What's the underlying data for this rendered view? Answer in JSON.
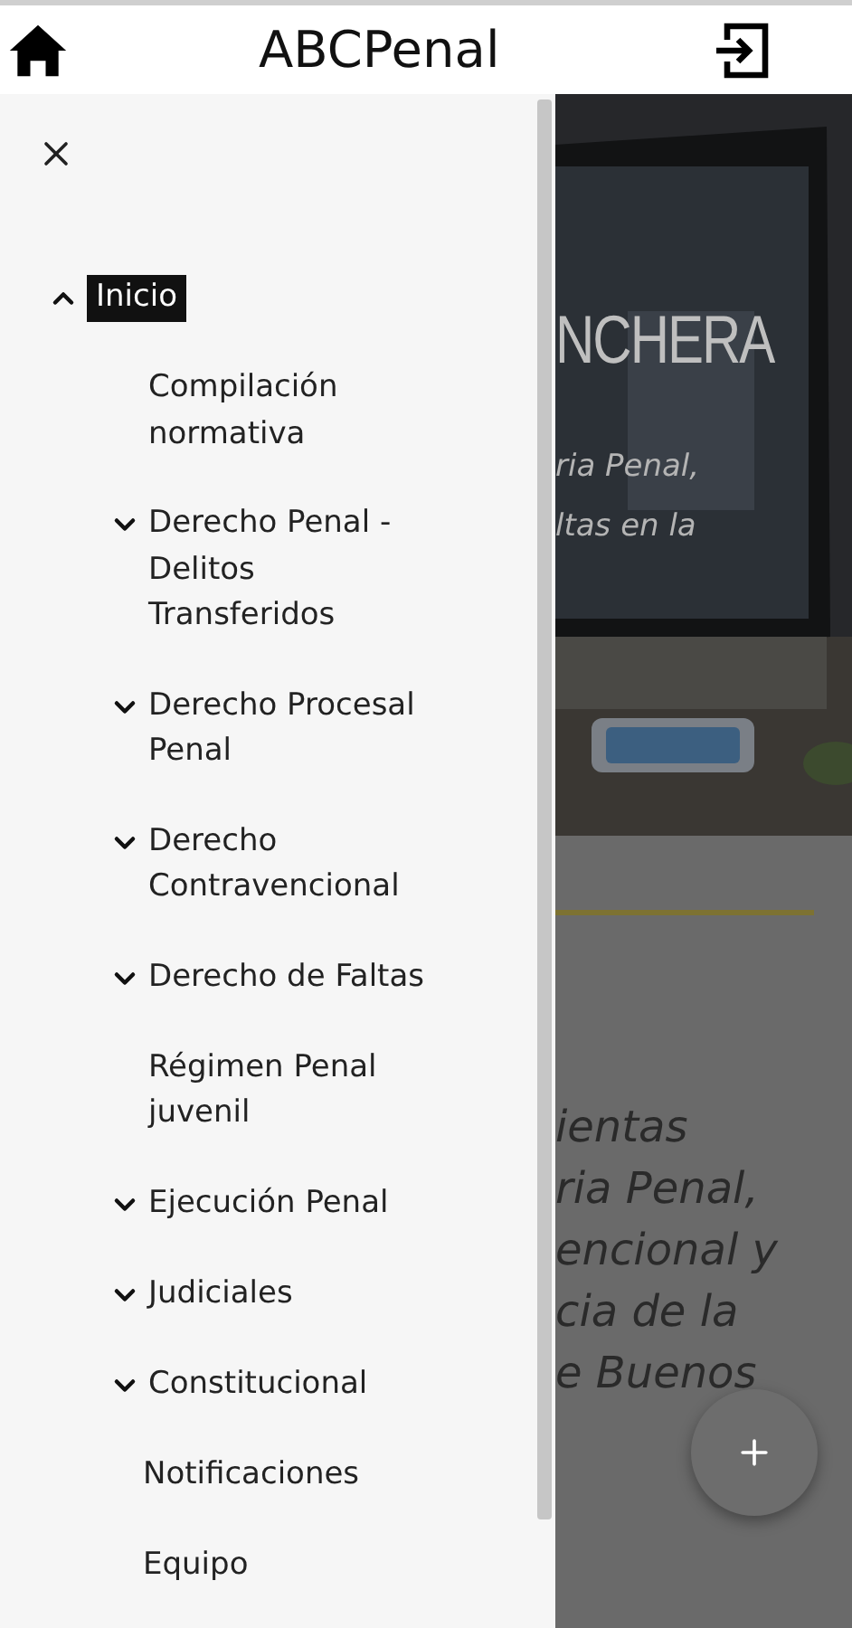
{
  "header": {
    "title": "ABCPenal"
  },
  "menu": [
    {
      "label": "Inicio",
      "kind": "group",
      "expanded": true,
      "selected": true,
      "children": [
        {
          "label": "Compilación normativa",
          "kind": "link",
          "selected": false
        },
        {
          "label": "Derecho Penal - Delitos Transferidos",
          "kind": "group",
          "expanded": false,
          "selected": false
        },
        {
          "label": "Derecho Procesal Penal",
          "kind": "group",
          "expanded": false,
          "selected": false
        },
        {
          "label": "Derecho Contravencional",
          "kind": "group",
          "expanded": false,
          "selected": false
        },
        {
          "label": "Derecho de Faltas",
          "kind": "group",
          "expanded": false,
          "selected": false
        },
        {
          "label": "Régimen Penal juvenil",
          "kind": "link",
          "selected": false
        },
        {
          "label": "Ejecución Penal",
          "kind": "group",
          "expanded": false,
          "selected": false
        },
        {
          "label": "Judiciales",
          "kind": "group",
          "expanded": false,
          "selected": false
        },
        {
          "label": "Constitucional",
          "kind": "group",
          "expanded": false,
          "selected": false
        }
      ]
    },
    {
      "label": "Notificaciones",
      "kind": "link",
      "selected": false
    },
    {
      "label": "Equipo",
      "kind": "link",
      "selected": false
    }
  ],
  "background": {
    "hero_heading": "NCHERA",
    "hero_lines": [
      "ria Penal,",
      "ltas en la"
    ],
    "body_lines": [
      "ientas",
      "ria Penal,",
      "encional y",
      "cia de la",
      "e Buenos"
    ]
  }
}
